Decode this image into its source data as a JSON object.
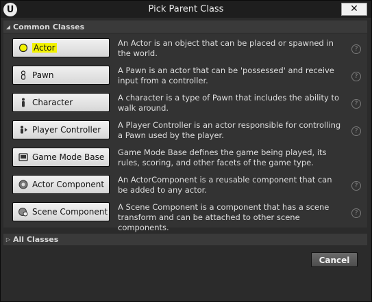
{
  "window": {
    "title": "Pick Parent Class",
    "close_glyph": "✕",
    "logo_glyph": "U"
  },
  "common_classes": {
    "header": "Common Classes",
    "items": [
      {
        "label": "Actor",
        "icon": "actor-icon",
        "desc": "An Actor is an object that can be placed or spawned in the world.",
        "highlight": true
      },
      {
        "label": "Pawn",
        "icon": "pawn-icon",
        "desc": "A Pawn is an actor that can be 'possessed' and receive input from a controller."
      },
      {
        "label": "Character",
        "icon": "character-icon",
        "desc": "A character is a type of Pawn that includes the ability to walk around."
      },
      {
        "label": "Player Controller",
        "icon": "player-controller-icon",
        "desc": "A Player Controller is an actor responsible for controlling a Pawn used by the player."
      },
      {
        "label": "Game Mode Base",
        "icon": "game-mode-icon",
        "desc": "Game Mode Base defines the game being played, its rules, scoring, and other facets of the game type."
      },
      {
        "label": "Actor Component",
        "icon": "actor-component-icon",
        "desc": "An ActorComponent is a reusable component that can be added to any actor."
      },
      {
        "label": "Scene Component",
        "icon": "scene-component-icon",
        "desc": "A Scene Component is a component that has a scene transform and can be attached to other scene components."
      }
    ]
  },
  "all_classes": {
    "header": "All Classes"
  },
  "footer": {
    "cancel_label": "Cancel"
  },
  "colors": {
    "highlight": "#f2f200"
  }
}
